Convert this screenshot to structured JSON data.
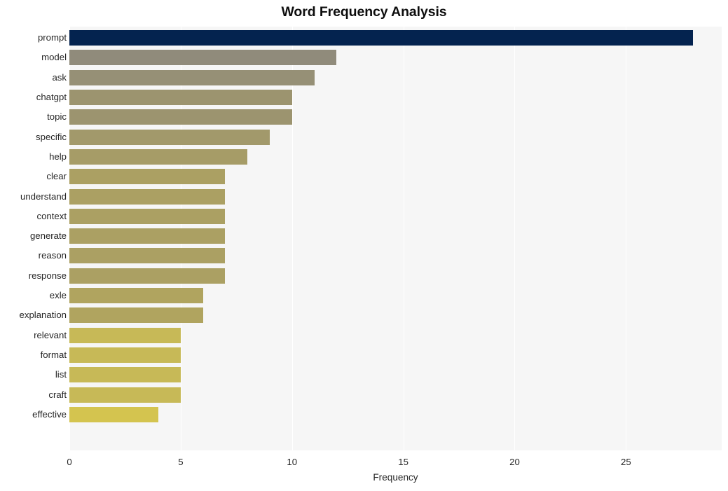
{
  "chart_data": {
    "type": "bar",
    "orientation": "horizontal",
    "title": "Word Frequency Analysis",
    "xlabel": "Frequency",
    "ylabel": "",
    "xlim": [
      0,
      29.3
    ],
    "ylim": [
      0,
      20
    ],
    "grid": true,
    "legend": null,
    "xticks": [
      0,
      5,
      10,
      15,
      20,
      25
    ],
    "xtick_labels": [
      "0",
      "5",
      "10",
      "15",
      "20",
      "25"
    ],
    "categories": [
      "prompt",
      "model",
      "ask",
      "chatgpt",
      "topic",
      "specific",
      "help",
      "clear",
      "understand",
      "context",
      "generate",
      "reason",
      "response",
      "exle",
      "explanation",
      "relevant",
      "format",
      "list",
      "craft",
      "effective"
    ],
    "values": [
      28,
      12,
      11,
      10,
      10,
      9,
      8,
      7,
      7,
      7,
      7,
      7,
      7,
      6,
      6,
      5,
      5,
      5,
      5,
      4
    ],
    "colormap": "cividis",
    "bar_colors": [
      "#04234f",
      "#908b7b",
      "#969076",
      "#9c946f",
      "#9c946f",
      "#a2996b",
      "#a69c67",
      "#aba063",
      "#aba063",
      "#aba063",
      "#aba063",
      "#aba063",
      "#aba063",
      "#b0a45f",
      "#b0a45f",
      "#c7b957",
      "#c7b957",
      "#c7b957",
      "#c7b957",
      "#d4c44f"
    ],
    "plot_background": "#f6f6f6",
    "figure_background": "#ffffff",
    "gridline_color": "#ffffff",
    "text_color": "#262626"
  }
}
